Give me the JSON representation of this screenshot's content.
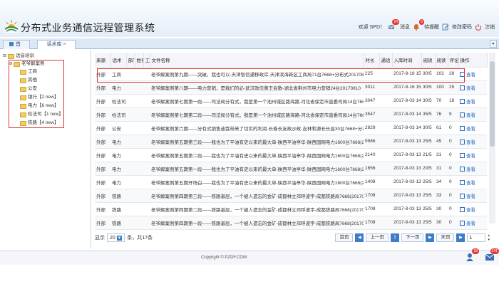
{
  "app": {
    "title": "分布式业务通信远程管理系统"
  },
  "header": {
    "welcome": "欢迎 SPD！",
    "msg_count": "24",
    "msg_label": "消息",
    "remind_count": "0",
    "remind_label": "待提醒",
    "change_pwd": "修改密码",
    "logout": "注销"
  },
  "tabs": {
    "home": "首页",
    "lib": "话术库"
  },
  "tree": {
    "root": "话音培训",
    "group": "老爷解案例",
    "items": [
      "工商",
      "其他",
      "公安",
      "银行【2 new】",
      "电力【6 new】",
      "检法司【1 new】",
      "铁路【4 new】"
    ]
  },
  "table": {
    "headers": [
      "来源",
      "话术",
      "部门",
      "姓名",
      "工",
      "文件名称",
      "时长",
      "通话",
      "入库时间",
      "阅读",
      "阅读",
      "评论",
      "操作"
    ],
    "op_label": "查看",
    "rows": [
      [
        "外部",
        "工商",
        "",
        "",
        "",
        "老爷解案例第九期——突破，我也可以-天津智信通移政岸-天津滨海新区工商局71台7668+分布式2017081",
        "225",
        "",
        "2017-8-16 15",
        "30/5",
        "102",
        "28"
      ],
      [
        "外部",
        "电力",
        "",
        "",
        "",
        "老爷解案例第八期——电力营销，是我们的必-武汉政信黄王会散-湖北省荆州市电力营销24台20170810",
        "3011",
        "",
        "2017-8-16 15",
        "30/5",
        "100",
        "25"
      ],
      [
        "外部",
        "检法司",
        "",
        "",
        "",
        "老爷解案例第七期第一段——司法局分有式，我是第一个池州城区路海路-河北省保定市直委司局14台7668",
        "3047",
        "",
        "2017-8-03 14",
        "30/5",
        "70",
        "18"
      ],
      [
        "外部",
        "检法司",
        "",
        "",
        "",
        "老爷解案例第七期第二段——司法局分有式，我是第一个池州城区路海路-河北省保定市直委司局14台7668",
        "3547",
        "",
        "2017-8-03 14",
        "35/5",
        "76",
        "9"
      ],
      [
        "外部",
        "公安",
        "",
        "",
        "",
        "老爷解案例第六期——分有式销售迪我带来了切实的利润-长春长友政沙政-吉林和源长长县30台7668+分布式",
        "2829",
        "",
        "2017-8-03 14",
        "30/5",
        "61",
        "0"
      ],
      [
        "外部",
        "电力",
        "",
        "",
        "",
        "老爷解案例第五期第三段——我也为了平油有史以来的最大单-陕西平油亭华-陕西国网电力1600台7668(20",
        "9986",
        "",
        "2017-8-03 13",
        "25/5",
        "45",
        "0"
      ],
      [
        "外部",
        "电力",
        "",
        "",
        "",
        "老爷解案例第五期第二段——我也为了平油有史以来的最大单-陕西平油亭华-陕西国网电力1600台7668(20",
        "2140",
        "",
        "2017-8-03 13",
        "21/5",
        "31",
        "0"
      ],
      [
        "外部",
        "电力",
        "",
        "",
        "",
        "老爷解案例第五期第一段——我也为了平油有史以来的最大单-陕西平油亭华-陕西国网电力1600台7668(20",
        "1656",
        "",
        "2017-8-03 13",
        "20/5",
        "31",
        "0"
      ],
      [
        "外部",
        "电力",
        "",
        "",
        "",
        "老爷解案例第五期开场白——我也为了平油有史以来的最大单-陕西平油亭华-陕西国网电力1600台7668(20",
        "1408",
        "",
        "2017-8-03 13",
        "25/5",
        "34",
        "0"
      ],
      [
        "外部",
        "铁路",
        "",
        "",
        "",
        "老爷解案例第四期第三段——铁路基层，一个被人遗忘的金矿-成都林立邓呼波宇-成都铁路局7668(201708",
        "1708",
        "",
        "2017-8-03 13",
        "25/5",
        "33",
        "0"
      ],
      [
        "外部",
        "铁路",
        "",
        "",
        "",
        "老爷解案例第四期第二段——铁路基层，一个被人遗忘的金矿-成都林立邓呼波宇-成都铁路局7668(201708",
        "1708",
        "",
        "2017-8-03 13",
        "25/5",
        "30",
        "0"
      ],
      [
        "外部",
        "铁路",
        "",
        "",
        "",
        "老爷解案例第四期第一段——铁路基层，一个被人遗忘的金矿-成都林立邓呼波宇-成都铁路局7668(201708",
        "1708",
        "",
        "2017-8-03 13",
        "25/5",
        "30",
        "0"
      ]
    ]
  },
  "pager": {
    "show": "显示",
    "page_size": "20",
    "total": "条，共17条",
    "first": "首页",
    "prev": "上一页",
    "page": "1",
    "next": "下一页",
    "last": "末页",
    "jump": "1"
  },
  "footer": {
    "copyright": "Copyright © PZDF.COM",
    "chat_count": "18",
    "mail_count": "241"
  }
}
